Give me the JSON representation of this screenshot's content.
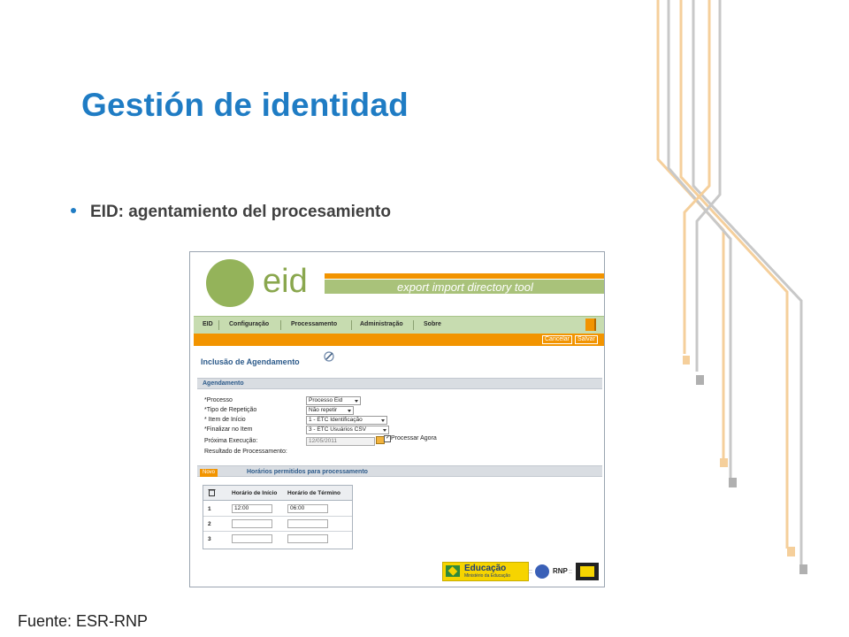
{
  "slide": {
    "title": "Gestión de identidad",
    "bullet": "EID: agentamiento del procesamiento",
    "source": "Fuente: ESR-RNP"
  },
  "screenshot": {
    "logo_word": "eid",
    "tool_name": "export import directory tool",
    "nav": [
      "EID",
      "Configuração",
      "Processamento",
      "Administração",
      "Sobre"
    ],
    "actions": {
      "cancel": "Cancelar",
      "save": "Salvar"
    },
    "page_title": "Inclusão de Agendamento",
    "section1": "Agendamento",
    "form": {
      "processo_label": "*Processo",
      "processo_value": "Processo Eid",
      "tipo_label": "*Tipo de Repetição",
      "tipo_value": "Não repetir",
      "item_inicio_label": "* Item de Início",
      "item_inicio_value": "1 - ETC Identificação",
      "finalizar_label": "*Finalizar no Item",
      "finalizar_value": "3 - ETC Usuários CSV",
      "proxima_label": "Próxima Execução:",
      "proxima_value": "12/05/2011",
      "processar_label": "Processar Agora",
      "resultado_label": "Resultado de Processamento:"
    },
    "section2": "Horários permitidos para processamento",
    "novo": "Novo",
    "table": {
      "headers": [
        "Horário de Início",
        "Horário de Término"
      ],
      "rows": [
        {
          "n": "1",
          "start": "12:00",
          "end": "06:00"
        },
        {
          "n": "2",
          "start": "",
          "end": ""
        },
        {
          "n": "3",
          "start": "",
          "end": ""
        }
      ]
    },
    "footer": {
      "educ_title": "Educação",
      "educ_sub": "Ministério da Educação",
      "rnp": "RNP"
    }
  },
  "colors": {
    "title_blue": "#1f7cc4",
    "orange": "#f29400",
    "green": "#94b35a"
  }
}
